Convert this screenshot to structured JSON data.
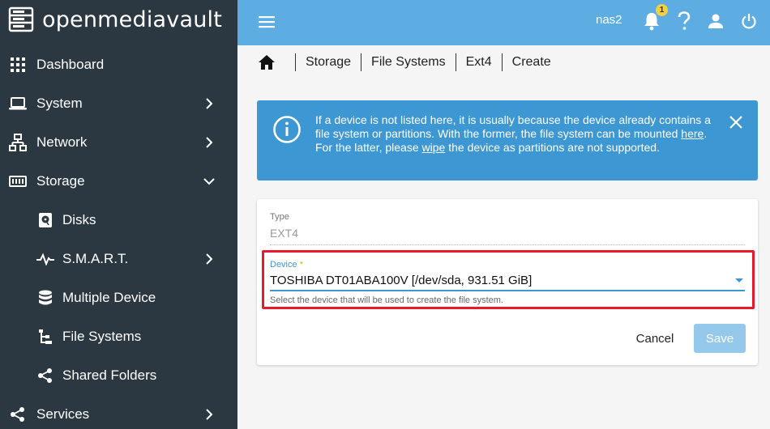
{
  "app": {
    "brand": "openmediavault"
  },
  "topbar": {
    "hostname": "nas2",
    "notification_count": "1"
  },
  "sidebar": {
    "items": [
      {
        "label": "Dashboard",
        "icon": "dashboard-grid-icon"
      },
      {
        "label": "System",
        "icon": "laptop-icon",
        "expanded": false
      },
      {
        "label": "Network",
        "icon": "network-icon",
        "expanded": false
      },
      {
        "label": "Storage",
        "icon": "storage-icon",
        "expanded": true
      },
      {
        "label": "Disks",
        "icon": "disk-icon"
      },
      {
        "label": "S.M.A.R.T.",
        "icon": "pulse-icon",
        "expanded": false
      },
      {
        "label": "Multiple Device",
        "icon": "database-icon"
      },
      {
        "label": "File Systems",
        "icon": "file-tree-icon"
      },
      {
        "label": "Shared Folders",
        "icon": "share-icon"
      },
      {
        "label": "Services",
        "icon": "share-icon",
        "expanded": false
      }
    ]
  },
  "breadcrumb": [
    "Storage",
    "File Systems",
    "Ext4",
    "Create"
  ],
  "alert": {
    "text_before_here": "If a device is not listed here, it is usually because the device already contains a file system or partitions. With the former, the file system can be mounted ",
    "here_link": "here",
    "text_middle": ". For the latter, please ",
    "wipe_link": "wipe",
    "text_after": " the device as partitions are not supported."
  },
  "form": {
    "type_label": "Type",
    "type_value": "EXT4",
    "device_label": "Device",
    "device_required": "*",
    "device_value": "TOSHIBA DT01ABA100V [/dev/sda, 931.51 GiB]",
    "device_hint": "Select the device that will be used to create the file system.",
    "cancel_label": "Cancel",
    "save_label": "Save"
  },
  "colors": {
    "sidebar_bg": "#2b3741",
    "topbar_bg": "#5dade2",
    "alert_bg": "#3c97d3",
    "highlight": "#e8192c",
    "save_button": "#94c9ec"
  }
}
